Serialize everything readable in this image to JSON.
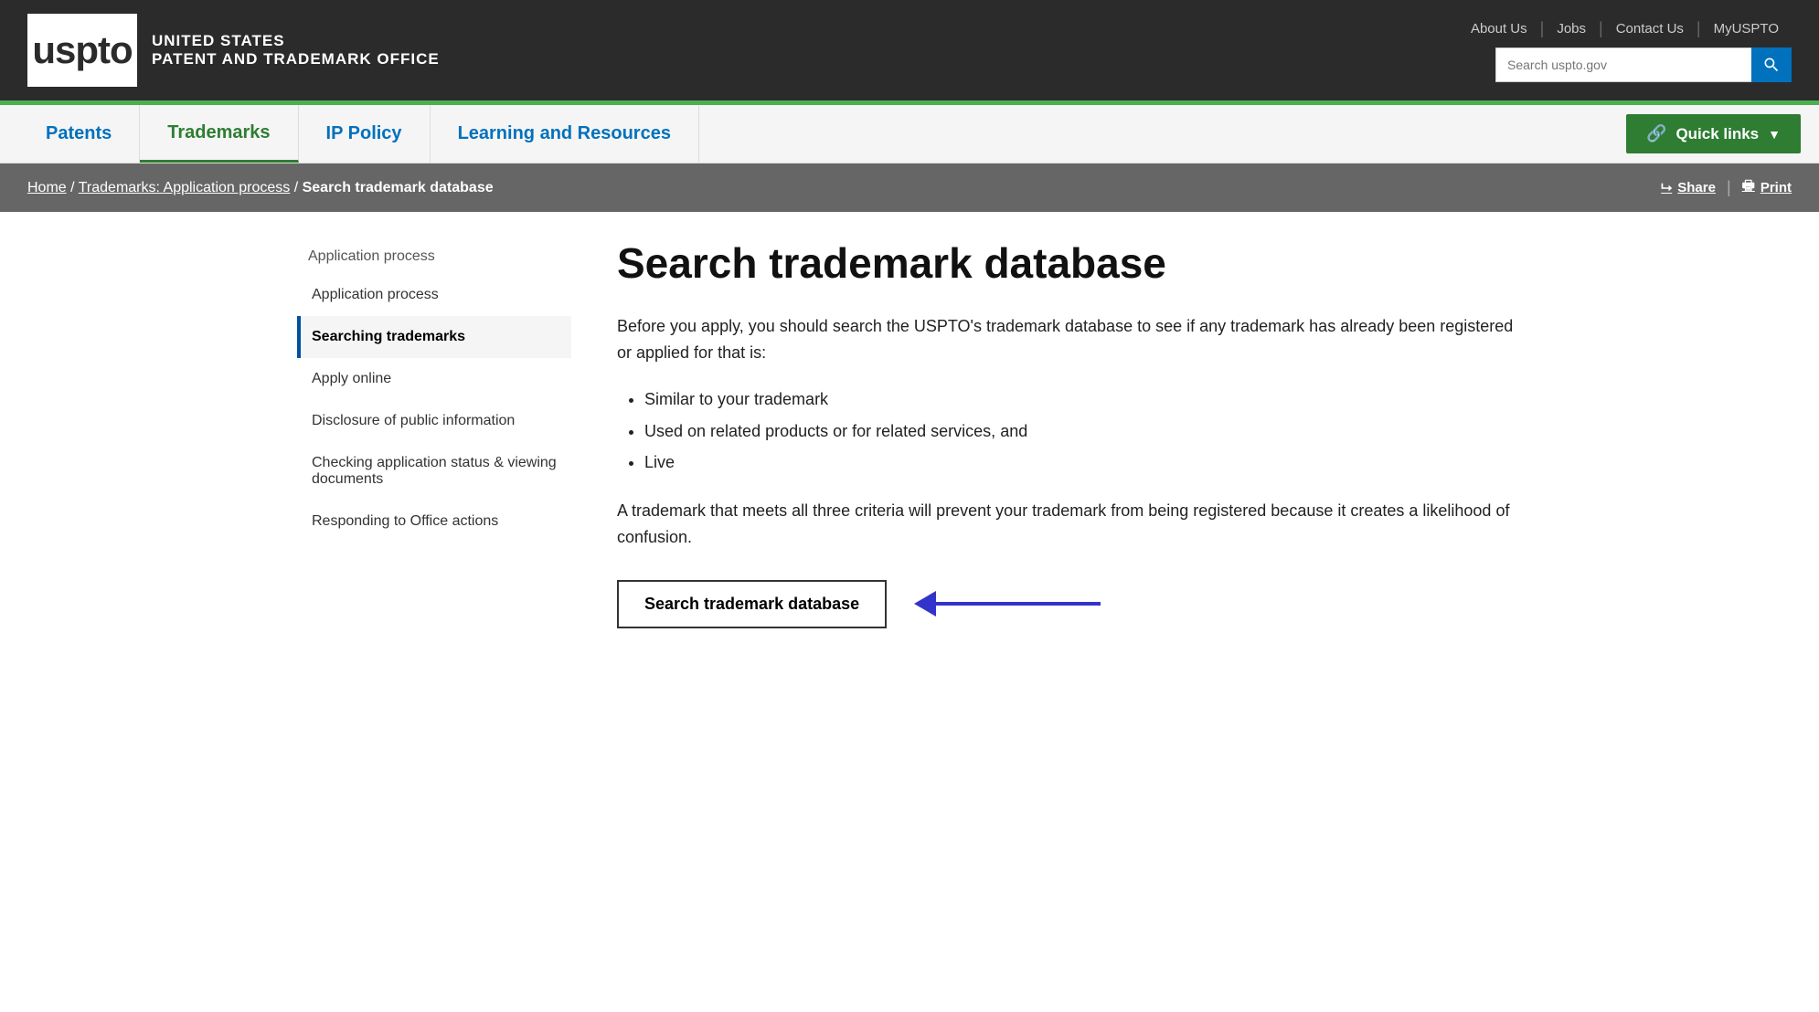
{
  "topBar": {
    "logoText": "uspto",
    "agencyLine1": "UNITED STATES",
    "agencyLine2": "PATENT AND TRADEMARK OFFICE",
    "links": [
      {
        "label": "About Us",
        "href": "#"
      },
      {
        "label": "Jobs",
        "href": "#"
      },
      {
        "label": "Contact Us",
        "href": "#"
      },
      {
        "label": "MyUSPTO",
        "href": "#"
      }
    ],
    "searchPlaceholder": "Search uspto.gov"
  },
  "mainNav": {
    "items": [
      {
        "label": "Patents",
        "active": false
      },
      {
        "label": "Trademarks",
        "active": true
      },
      {
        "label": "IP Policy",
        "active": false
      },
      {
        "label": "Learning and Resources",
        "active": false
      }
    ],
    "quickLinks": "Quick links"
  },
  "breadcrumb": {
    "home": "Home",
    "trademarks": "Trademarks: Application process",
    "current": "Search trademark database",
    "shareLabel": "Share",
    "printLabel": "Print"
  },
  "sidebar": {
    "sectionTitle": "Application process",
    "items": [
      {
        "label": "Application process",
        "active": false
      },
      {
        "label": "Searching trademarks",
        "active": true
      },
      {
        "label": "Apply online",
        "active": false
      },
      {
        "label": "Disclosure of public information",
        "active": false
      },
      {
        "label": "Checking application status & viewing documents",
        "active": false
      },
      {
        "label": "Responding to Office actions",
        "active": false
      }
    ]
  },
  "mainContent": {
    "pageTitle": "Search trademark database",
    "introText": "Before you apply, you should search the USPTO's trademark database to see if any trademark has already been registered or applied for that is:",
    "bullets": [
      "Similar to your trademark",
      "Used on related products or for related services, and",
      "Live"
    ],
    "conclusionText": "A trademark that meets all three criteria will prevent your trademark from being registered because it creates a likelihood of confusion.",
    "ctaButton": "Search trademark database"
  }
}
